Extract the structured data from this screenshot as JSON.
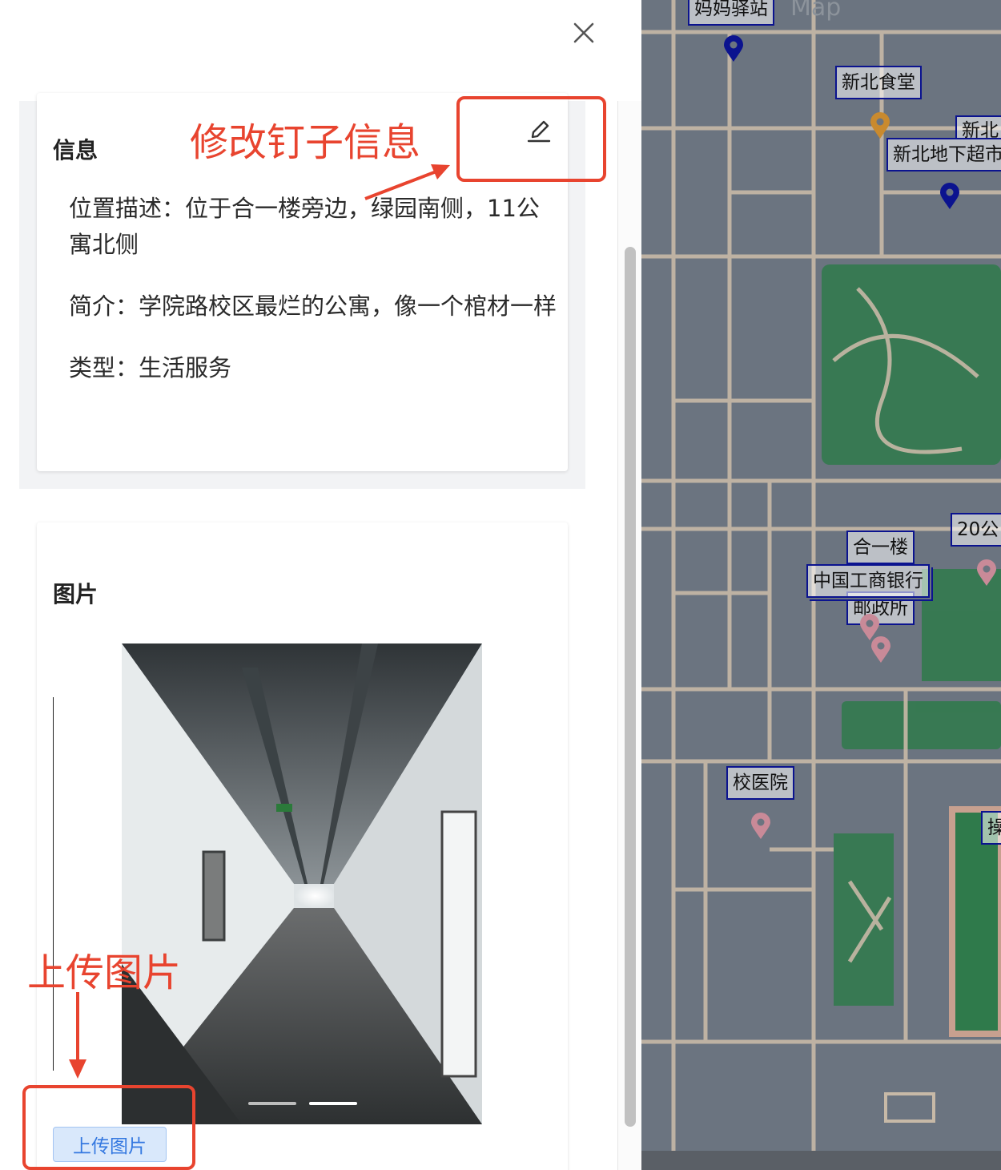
{
  "drawer": {
    "close_icon": "close-icon",
    "info_card": {
      "title": "信息",
      "edit_icon": "pencil-icon",
      "lines": [
        "位置描述：位于合一楼旁边，绿园南侧，11公寓北侧",
        "简介：学院路校区最烂的公寓，像一个棺材一样",
        "类型：生活服务"
      ]
    },
    "photo_card": {
      "title": "图片",
      "upload_label": "上传图片",
      "carousel": {
        "count": 2,
        "active": 2
      }
    }
  },
  "annotations": {
    "edit_note": "修改钉子信息",
    "upload_note": "上传图片",
    "color": "#e8442f"
  },
  "map": {
    "watermark": "Map",
    "labels": [
      "妈妈驿站",
      "新北食堂",
      "新北",
      "新北地下超市",
      "20公",
      "合一楼",
      "中国工商银行",
      "邮政所",
      "校医院",
      "操"
    ],
    "marker_colors": {
      "navy": "#0b138f",
      "orange": "#c98a2e",
      "pink": "#c98a98"
    }
  }
}
